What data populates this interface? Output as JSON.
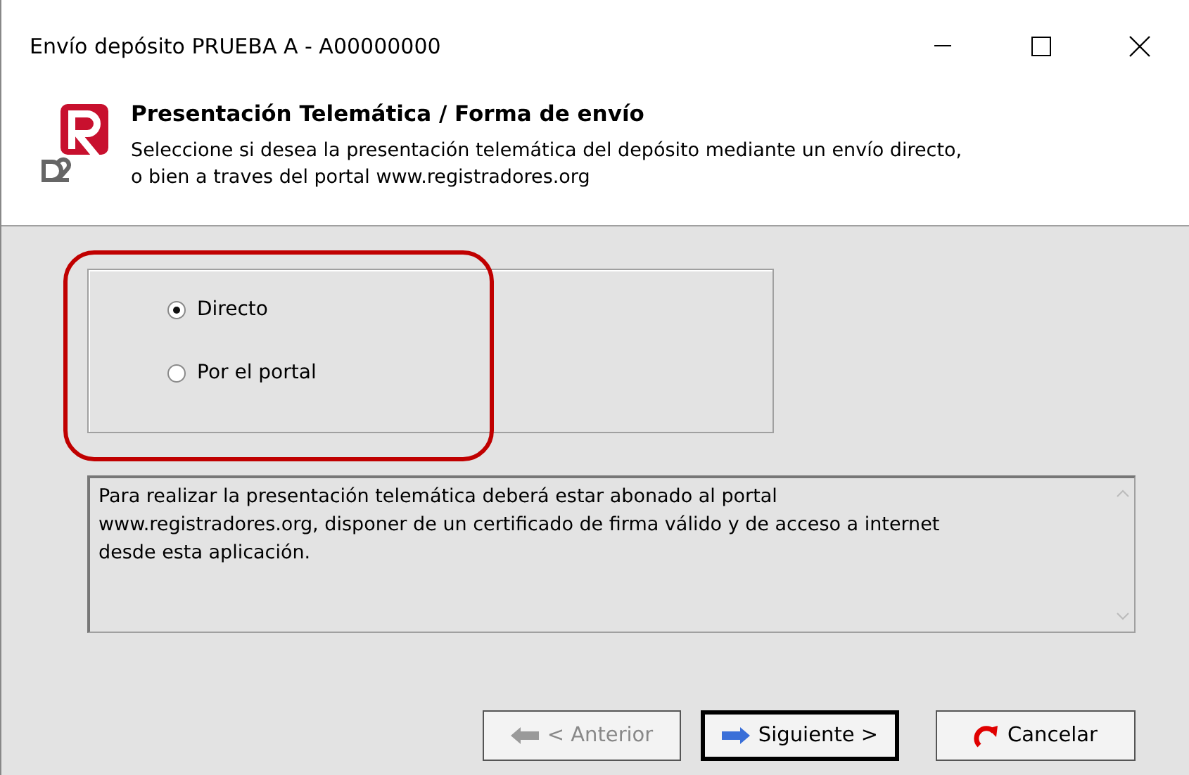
{
  "window": {
    "title": "Envío depósito PRUEBA A - A00000000"
  },
  "header": {
    "title": "Presentación Telemática / Forma de envío",
    "description": "Seleccione si desea la presentación telemática del depósito mediante un envío directo,\no bien a traves del portal www.registradores.org"
  },
  "options": [
    {
      "label": "Directo",
      "selected": true
    },
    {
      "label": "Por el portal",
      "selected": false
    }
  ],
  "highlight": {
    "on": true
  },
  "info": "Para realizar la presentación telemática deberá estar abonado al portal\nwww.registradores.org, disponer de un certificado de firma válido y de acceso a internet\ndesde esta aplicación.",
  "buttons": [
    {
      "kind": "back",
      "label": "< Anterior",
      "disabled": true,
      "default": false
    },
    {
      "kind": "next",
      "label": "Siguiente >",
      "disabled": false,
      "default": true
    },
    {
      "kind": "cancel",
      "label": "Cancelar",
      "disabled": false,
      "default": false
    }
  ]
}
